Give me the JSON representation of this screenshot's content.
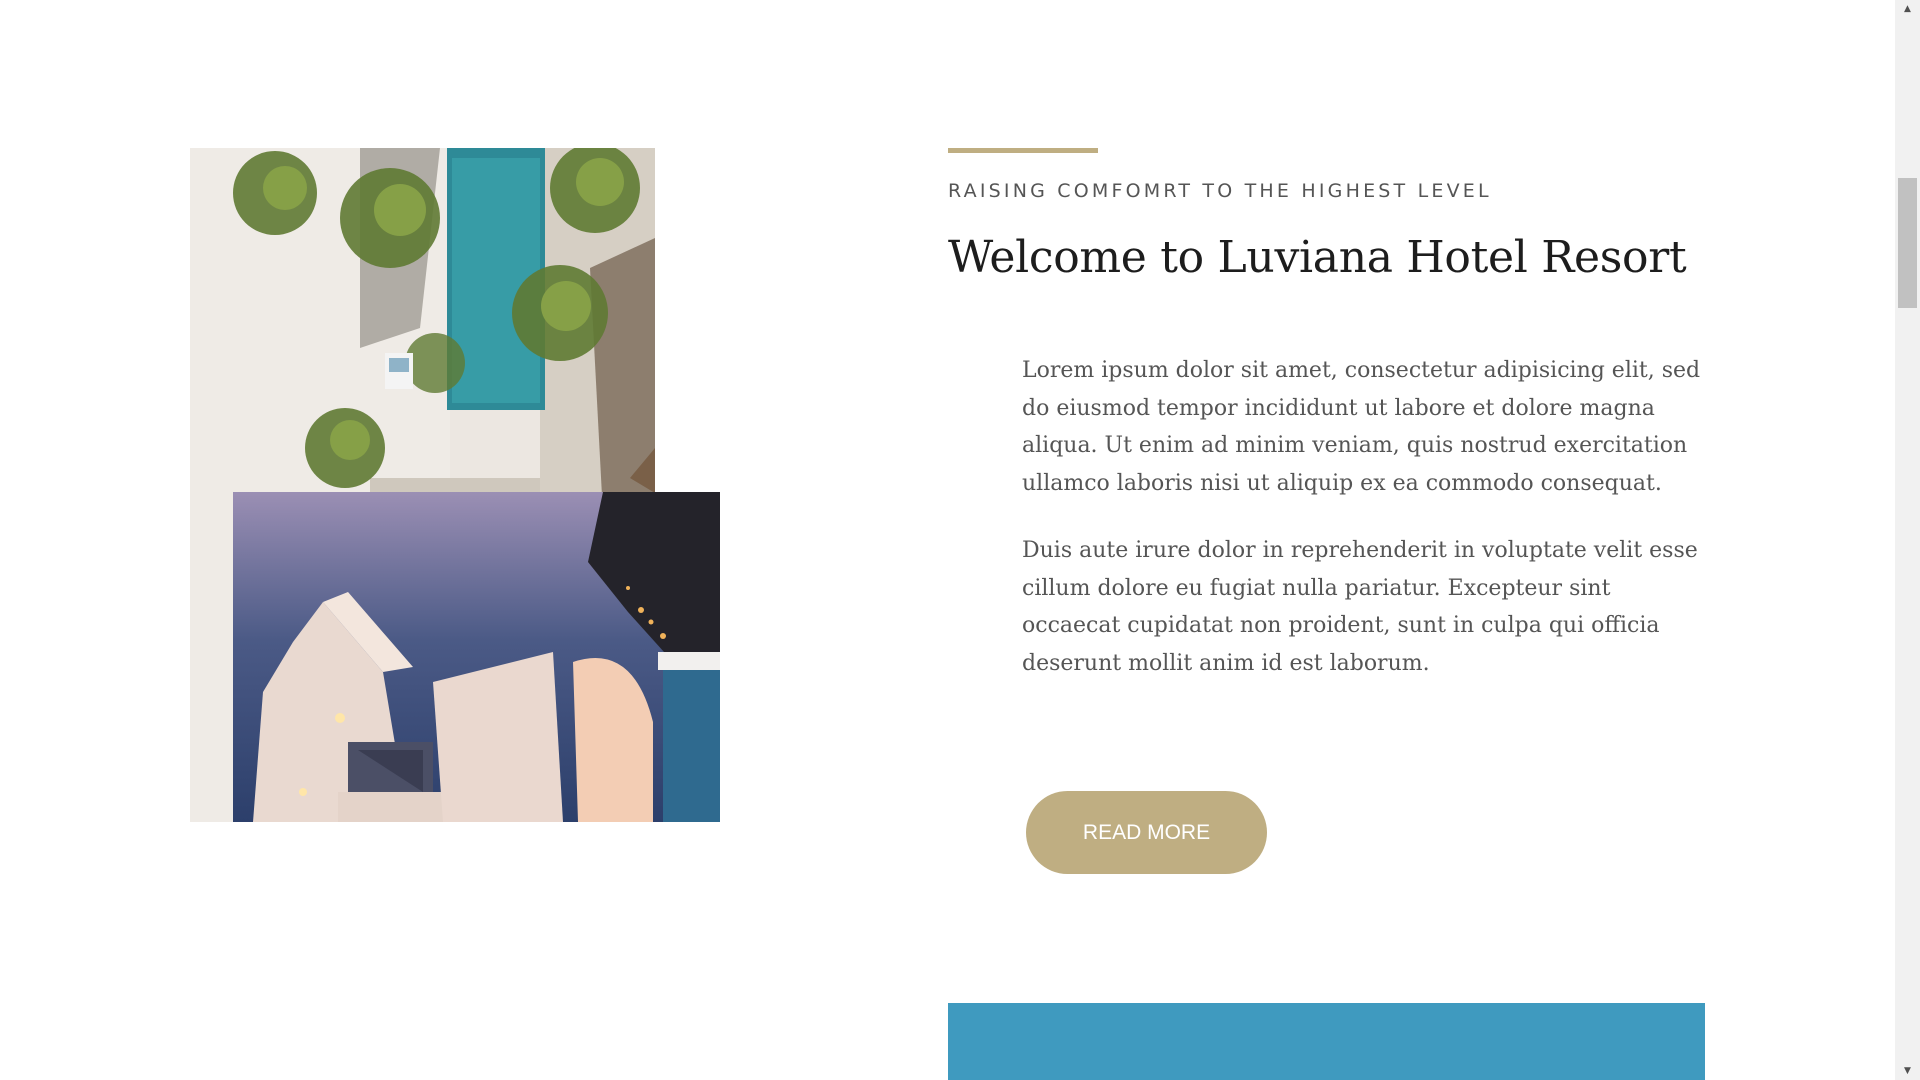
{
  "about": {
    "eyebrow": "RAISING COMFOMRT TO THE HIGHEST LEVEL",
    "title": "Welcome to Luviana Hotel Resort",
    "paragraphs": [
      "Lorem ipsum dolor sit amet, consectetur adipisicing elit, sed do eiusmod tempor incididunt ut labore et dolore magna aliqua. Ut enim ad minim veniam, quis nostrud exercitation ullamco laboris nisi ut aliquip ex ea commodo consequat.",
      "Duis aute irure dolor in reprehenderit in voluptate velit esse cillum dolore eu fugiat nulla pariatur. Excepteur sint occaecat cupidatat non proident, sunt in culpa qui officia deserunt mollit anim id est laborum."
    ],
    "button_label": "READ MORE",
    "images": {
      "top": "aerial-pool-palms-photo",
      "bottom": "santorini-sea-terrace-photo"
    }
  },
  "colors": {
    "accent": "#bfae82",
    "heading": "#1d1d1d",
    "body": "#555555",
    "blue_block": "#3f9abf"
  },
  "scrollbar": {
    "up_icon": "scroll-up-arrow-icon",
    "down_icon": "scroll-down-arrow-icon"
  }
}
